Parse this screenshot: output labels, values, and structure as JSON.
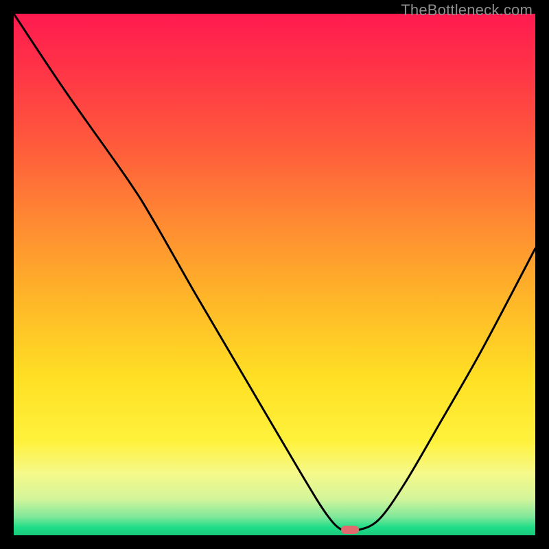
{
  "watermark": "TheBottleneck.com",
  "colors": {
    "bg": "#000000",
    "marker": "#e16a6f",
    "curve": "#000000",
    "gradient_stops": [
      {
        "offset": 0,
        "color": "#ff1a50"
      },
      {
        "offset": 0.1,
        "color": "#ff3247"
      },
      {
        "offset": 0.25,
        "color": "#ff5a3c"
      },
      {
        "offset": 0.4,
        "color": "#ff8a32"
      },
      {
        "offset": 0.55,
        "color": "#ffb728"
      },
      {
        "offset": 0.7,
        "color": "#ffe024"
      },
      {
        "offset": 0.82,
        "color": "#fff23c"
      },
      {
        "offset": 0.88,
        "color": "#f6f989"
      },
      {
        "offset": 0.93,
        "color": "#d4f59a"
      },
      {
        "offset": 0.965,
        "color": "#7ee89a"
      },
      {
        "offset": 0.985,
        "color": "#1fdd87"
      },
      {
        "offset": 1.0,
        "color": "#18c97b"
      }
    ]
  },
  "chart_data": {
    "type": "line",
    "title": "",
    "xlabel": "",
    "ylabel": "",
    "xlim": [
      0,
      100
    ],
    "ylim": [
      0,
      100
    ],
    "grid": false,
    "series": [
      {
        "name": "bottleneck-curve",
        "x": [
          0,
          10,
          22,
          27,
          35,
          45,
          55,
          60,
          63,
          66,
          70,
          75,
          82,
          90,
          100
        ],
        "y": [
          100,
          85,
          68,
          60,
          46,
          29,
          12,
          4,
          1,
          1,
          3,
          10,
          22,
          36,
          55
        ]
      }
    ],
    "annotations": [
      {
        "name": "optimal-marker",
        "x": 64.5,
        "y": 1
      }
    ]
  }
}
